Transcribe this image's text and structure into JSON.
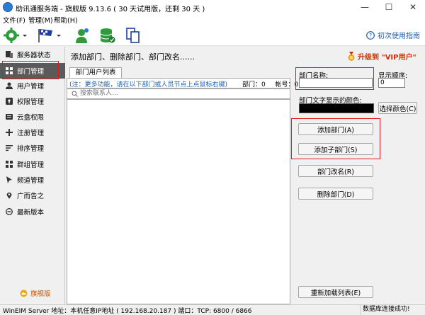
{
  "window": {
    "title": "助讯通服务端 - 旗舰版   9.13.6   ( 30 天试用版，还剩 30 天 )",
    "minimize": "—",
    "maximize": "☐",
    "close": "✕"
  },
  "menu": [
    {
      "label": "文件(F)"
    },
    {
      "label": "管理(M)"
    },
    {
      "label": "帮助(H)"
    }
  ],
  "toolbar": {
    "help_label": "初次使用指南"
  },
  "sidebar": {
    "items": [
      {
        "label": "服务器状态",
        "icon": "server-icon"
      },
      {
        "label": "部门管理",
        "icon": "grid-icon"
      },
      {
        "label": "用户管理",
        "icon": "user-icon"
      },
      {
        "label": "权限管理",
        "icon": "key-icon"
      },
      {
        "label": "云盘权限",
        "icon": "cloud-icon"
      },
      {
        "label": "注册管理",
        "icon": "plus-icon"
      },
      {
        "label": "排序管理",
        "icon": "sort-icon"
      },
      {
        "label": "群组管理",
        "icon": "group-icon"
      },
      {
        "label": "频道管理",
        "icon": "channel-icon"
      },
      {
        "label": "广而告之",
        "icon": "location-icon"
      },
      {
        "label": "最新版本",
        "icon": "version-icon"
      }
    ],
    "edition": "旗舰版"
  },
  "main": {
    "header": "添加部门、删除部门、部门改名......",
    "vip_label": "升级到 \"VIP用户\"",
    "tab_label": "部门用户列表",
    "note": "(注：更多功能，请在以下部门或人员节点上点鼠标右键)",
    "dept_count_label": "部门：0",
    "account_count_label": "帐号：0",
    "search_placeholder": "搜索联系人..."
  },
  "form": {
    "dept_name_label": "部门名称:",
    "dept_name_value": "",
    "order_label": "显示顺序:",
    "order_value": "0",
    "color_label": "部门文字显示的颜色:",
    "color_value": "#000000",
    "choose_color_button": "选择颜色(C)",
    "add_dept_button": "添加部门(A)",
    "add_subdept_button": "添加子部门(S)",
    "rename_button": "部门改名(R)",
    "delete_button": "删除部门(D)",
    "reload_button": "重新加载列表(E)"
  },
  "status": {
    "left": "WinEIM Server  地址：本机任意IP地址 ( 192.168.20.187 )   端口：TCP: 6800 / 6866",
    "right": "数据库连接成功!"
  }
}
